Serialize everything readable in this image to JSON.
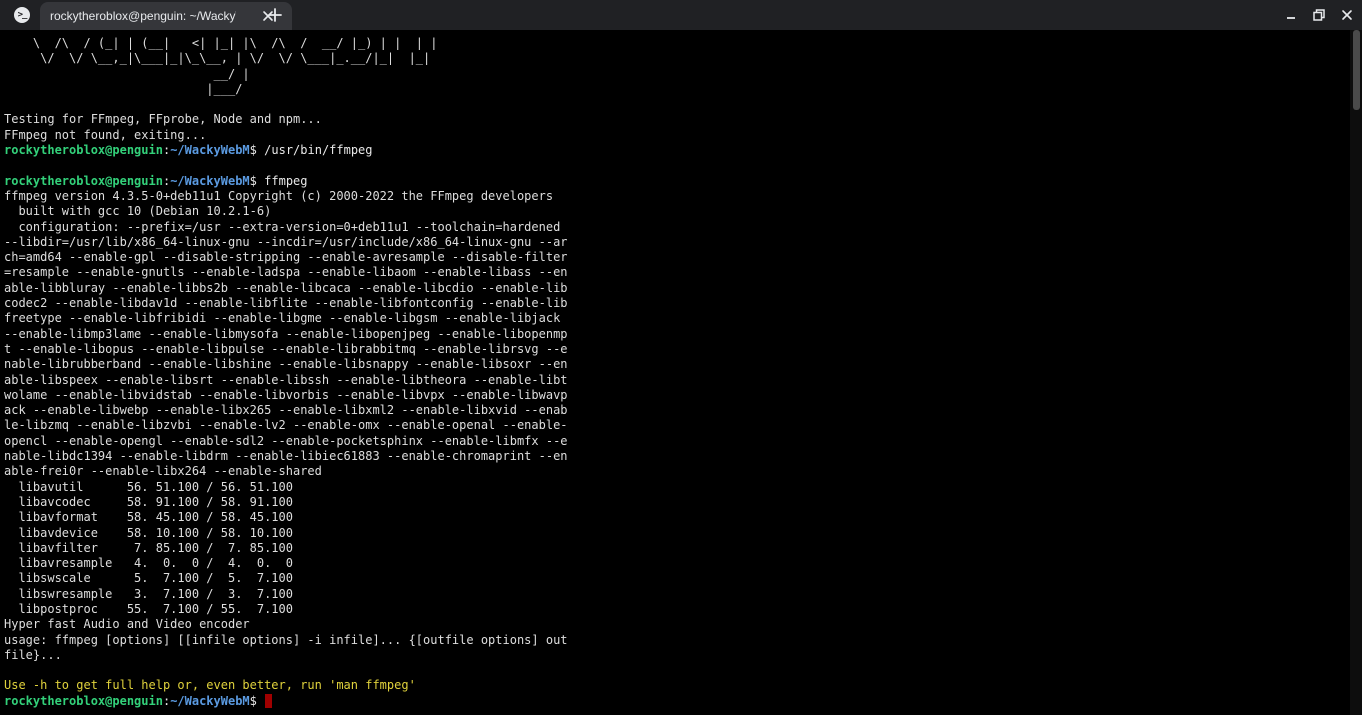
{
  "titlebar": {
    "tab_title": "rockytheroblox@penguin: ~/WackyWebM",
    "app_icon_text": ">_"
  },
  "prompt": {
    "user_host": "rockytheroblox@penguin",
    "separator": ":",
    "path": "~/WackyWebM",
    "symbol": "$"
  },
  "ascii_art": [
    "    \\  /\\  / (_| | (__|   <| |_| |\\  /\\  /  __/ |_) | |  | |",
    "     \\/  \\/ \\__,_|\\___|_|\\_\\__, | \\/  \\/ \\___|_.__/|_|  |_|",
    "                             __/ |",
    "                            |___/"
  ],
  "output_before": [
    "Testing for FFmpeg, FFprobe, Node and npm...",
    "FFmpeg not found, exiting..."
  ],
  "cmd1": "/usr/bin/ffmpeg",
  "cmd2": "ffmpeg",
  "ffmpeg_output": [
    "ffmpeg version 4.3.5-0+deb11u1 Copyright (c) 2000-2022 the FFmpeg developers",
    "  built with gcc 10 (Debian 10.2.1-6)",
    "  configuration: --prefix=/usr --extra-version=0+deb11u1 --toolchain=hardened",
    "--libdir=/usr/lib/x86_64-linux-gnu --incdir=/usr/include/x86_64-linux-gnu --ar",
    "ch=amd64 --enable-gpl --disable-stripping --enable-avresample --disable-filter",
    "=resample --enable-gnutls --enable-ladspa --enable-libaom --enable-libass --en",
    "able-libbluray --enable-libbs2b --enable-libcaca --enable-libcdio --enable-lib",
    "codec2 --enable-libdav1d --enable-libflite --enable-libfontconfig --enable-lib",
    "freetype --enable-libfribidi --enable-libgme --enable-libgsm --enable-libjack",
    "--enable-libmp3lame --enable-libmysofa --enable-libopenjpeg --enable-libopenmp",
    "t --enable-libopus --enable-libpulse --enable-librabbitmq --enable-librsvg --e",
    "nable-librubberband --enable-libshine --enable-libsnappy --enable-libsoxr --en",
    "able-libspeex --enable-libsrt --enable-libssh --enable-libtheora --enable-libt",
    "wolame --enable-libvidstab --enable-libvorbis --enable-libvpx --enable-libwavp",
    "ack --enable-libwebp --enable-libx265 --enable-libxml2 --enable-libxvid --enab",
    "le-libzmq --enable-libzvbi --enable-lv2 --enable-omx --enable-openal --enable-",
    "opencl --enable-opengl --enable-sdl2 --enable-pocketsphinx --enable-libmfx --e",
    "nable-libdc1394 --enable-libdrm --enable-libiec61883 --enable-chromaprint --en",
    "able-frei0r --enable-libx264 --enable-shared",
    "  libavutil      56. 51.100 / 56. 51.100",
    "  libavcodec     58. 91.100 / 58. 91.100",
    "  libavformat    58. 45.100 / 58. 45.100",
    "  libavdevice    58. 10.100 / 58. 10.100",
    "  libavfilter     7. 85.100 /  7. 85.100",
    "  libavresample   4.  0.  0 /  4.  0.  0",
    "  libswscale      5.  7.100 /  5.  7.100",
    "  libswresample   3.  7.100 /  3.  7.100",
    "  libpostproc    55.  7.100 / 55.  7.100",
    "Hyper fast Audio and Video encoder",
    "usage: ffmpeg [options] [[infile options] -i infile]... {[outfile options] out",
    "file}..."
  ],
  "help_hint": "Use -h to get full help or, even better, run 'man ffmpeg'",
  "colors": {
    "background": "#000000",
    "text": "#dedede",
    "prompt_user": "#33d17a",
    "prompt_path": "#5b9be2",
    "hint": "#e0d23c",
    "cursor": "#a00000",
    "titlebar": "#202124",
    "tab": "#35363a"
  },
  "icons": {
    "tab_close": "close-icon",
    "new_tab": "plus-icon",
    "minimize": "minimize-icon",
    "restore": "restore-icon",
    "close": "close-icon"
  }
}
